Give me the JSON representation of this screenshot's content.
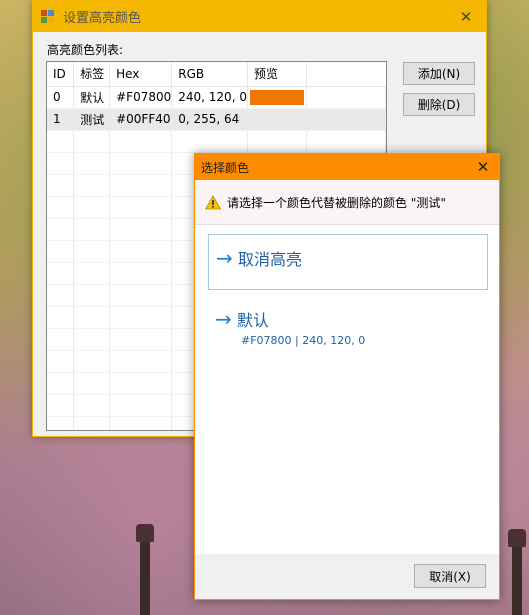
{
  "main": {
    "title": "设置高亮颜色",
    "list_label": "高亮颜色列表:",
    "columns": [
      "ID",
      "标签",
      "Hex",
      "RGB",
      "预览"
    ],
    "rows": [
      {
        "id": "0",
        "label": "默认",
        "hex": "#F07800",
        "rgb": "240, 120, 0",
        "preview": "#F07800"
      },
      {
        "id": "1",
        "label": "测试",
        "hex": "#00FF40",
        "rgb": "0, 255, 64",
        "preview": ""
      }
    ],
    "add_label": "添加(N)",
    "delete_label": "删除(D)"
  },
  "dialog": {
    "title": "选择颜色",
    "warning": "请选择一个颜色代替被删除的颜色 \"测试\"",
    "option_cancel": "取消高亮",
    "option_default": "默认",
    "option_default_detail": "#F07800 | 240, 120, 0",
    "cancel_button": "取消(X)"
  },
  "colors": {
    "main_title_bar": "#f5b800",
    "dialog_title_bar": "#ff8c00",
    "link": "#1f5fa6"
  }
}
